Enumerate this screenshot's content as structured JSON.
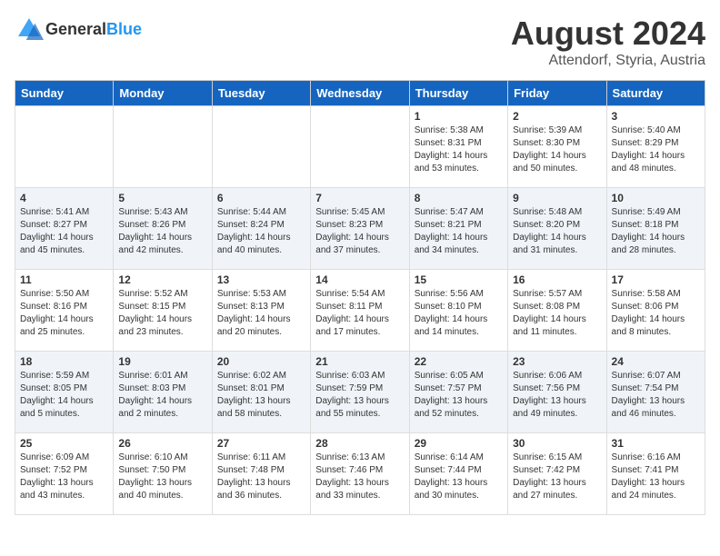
{
  "header": {
    "logo_general": "General",
    "logo_blue": "Blue",
    "month_year": "August 2024",
    "location": "Attendorf, Styria, Austria"
  },
  "days_of_week": [
    "Sunday",
    "Monday",
    "Tuesday",
    "Wednesday",
    "Thursday",
    "Friday",
    "Saturday"
  ],
  "weeks": [
    [
      {
        "day": "",
        "info": ""
      },
      {
        "day": "",
        "info": ""
      },
      {
        "day": "",
        "info": ""
      },
      {
        "day": "",
        "info": ""
      },
      {
        "day": "1",
        "info": "Sunrise: 5:38 AM\nSunset: 8:31 PM\nDaylight: 14 hours\nand 53 minutes."
      },
      {
        "day": "2",
        "info": "Sunrise: 5:39 AM\nSunset: 8:30 PM\nDaylight: 14 hours\nand 50 minutes."
      },
      {
        "day": "3",
        "info": "Sunrise: 5:40 AM\nSunset: 8:29 PM\nDaylight: 14 hours\nand 48 minutes."
      }
    ],
    [
      {
        "day": "4",
        "info": "Sunrise: 5:41 AM\nSunset: 8:27 PM\nDaylight: 14 hours\nand 45 minutes."
      },
      {
        "day": "5",
        "info": "Sunrise: 5:43 AM\nSunset: 8:26 PM\nDaylight: 14 hours\nand 42 minutes."
      },
      {
        "day": "6",
        "info": "Sunrise: 5:44 AM\nSunset: 8:24 PM\nDaylight: 14 hours\nand 40 minutes."
      },
      {
        "day": "7",
        "info": "Sunrise: 5:45 AM\nSunset: 8:23 PM\nDaylight: 14 hours\nand 37 minutes."
      },
      {
        "day": "8",
        "info": "Sunrise: 5:47 AM\nSunset: 8:21 PM\nDaylight: 14 hours\nand 34 minutes."
      },
      {
        "day": "9",
        "info": "Sunrise: 5:48 AM\nSunset: 8:20 PM\nDaylight: 14 hours\nand 31 minutes."
      },
      {
        "day": "10",
        "info": "Sunrise: 5:49 AM\nSunset: 8:18 PM\nDaylight: 14 hours\nand 28 minutes."
      }
    ],
    [
      {
        "day": "11",
        "info": "Sunrise: 5:50 AM\nSunset: 8:16 PM\nDaylight: 14 hours\nand 25 minutes."
      },
      {
        "day": "12",
        "info": "Sunrise: 5:52 AM\nSunset: 8:15 PM\nDaylight: 14 hours\nand 23 minutes."
      },
      {
        "day": "13",
        "info": "Sunrise: 5:53 AM\nSunset: 8:13 PM\nDaylight: 14 hours\nand 20 minutes."
      },
      {
        "day": "14",
        "info": "Sunrise: 5:54 AM\nSunset: 8:11 PM\nDaylight: 14 hours\nand 17 minutes."
      },
      {
        "day": "15",
        "info": "Sunrise: 5:56 AM\nSunset: 8:10 PM\nDaylight: 14 hours\nand 14 minutes."
      },
      {
        "day": "16",
        "info": "Sunrise: 5:57 AM\nSunset: 8:08 PM\nDaylight: 14 hours\nand 11 minutes."
      },
      {
        "day": "17",
        "info": "Sunrise: 5:58 AM\nSunset: 8:06 PM\nDaylight: 14 hours\nand 8 minutes."
      }
    ],
    [
      {
        "day": "18",
        "info": "Sunrise: 5:59 AM\nSunset: 8:05 PM\nDaylight: 14 hours\nand 5 minutes."
      },
      {
        "day": "19",
        "info": "Sunrise: 6:01 AM\nSunset: 8:03 PM\nDaylight: 14 hours\nand 2 minutes."
      },
      {
        "day": "20",
        "info": "Sunrise: 6:02 AM\nSunset: 8:01 PM\nDaylight: 13 hours\nand 58 minutes."
      },
      {
        "day": "21",
        "info": "Sunrise: 6:03 AM\nSunset: 7:59 PM\nDaylight: 13 hours\nand 55 minutes."
      },
      {
        "day": "22",
        "info": "Sunrise: 6:05 AM\nSunset: 7:57 PM\nDaylight: 13 hours\nand 52 minutes."
      },
      {
        "day": "23",
        "info": "Sunrise: 6:06 AM\nSunset: 7:56 PM\nDaylight: 13 hours\nand 49 minutes."
      },
      {
        "day": "24",
        "info": "Sunrise: 6:07 AM\nSunset: 7:54 PM\nDaylight: 13 hours\nand 46 minutes."
      }
    ],
    [
      {
        "day": "25",
        "info": "Sunrise: 6:09 AM\nSunset: 7:52 PM\nDaylight: 13 hours\nand 43 minutes."
      },
      {
        "day": "26",
        "info": "Sunrise: 6:10 AM\nSunset: 7:50 PM\nDaylight: 13 hours\nand 40 minutes."
      },
      {
        "day": "27",
        "info": "Sunrise: 6:11 AM\nSunset: 7:48 PM\nDaylight: 13 hours\nand 36 minutes."
      },
      {
        "day": "28",
        "info": "Sunrise: 6:13 AM\nSunset: 7:46 PM\nDaylight: 13 hours\nand 33 minutes."
      },
      {
        "day": "29",
        "info": "Sunrise: 6:14 AM\nSunset: 7:44 PM\nDaylight: 13 hours\nand 30 minutes."
      },
      {
        "day": "30",
        "info": "Sunrise: 6:15 AM\nSunset: 7:42 PM\nDaylight: 13 hours\nand 27 minutes."
      },
      {
        "day": "31",
        "info": "Sunrise: 6:16 AM\nSunset: 7:41 PM\nDaylight: 13 hours\nand 24 minutes."
      }
    ]
  ]
}
